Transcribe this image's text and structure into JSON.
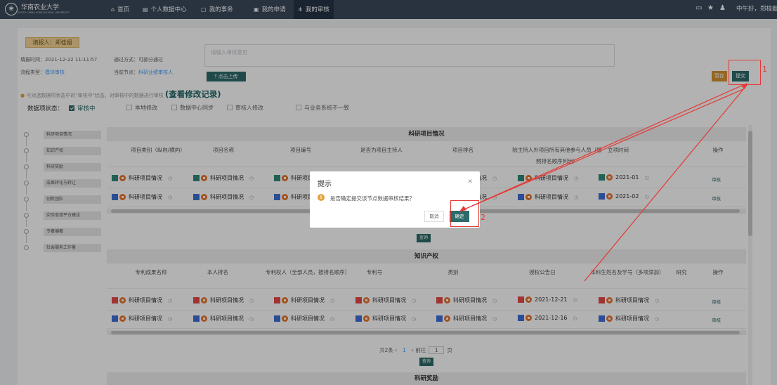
{
  "topbar": {
    "logo_text": "华南农业大学",
    "logo_sub": "SOUTH CHINA AGRICULTURAL UNIVERSITY",
    "nav": [
      {
        "label": "首页",
        "icon": "home-icon"
      },
      {
        "label": "个人数据中心",
        "icon": "id-card-icon"
      },
      {
        "label": "我的事务",
        "icon": "document-icon"
      },
      {
        "label": "我的申请",
        "icon": "form-icon"
      },
      {
        "label": "我的审核",
        "icon": "sitemap-icon"
      }
    ],
    "greeting": "中午好，郑桂姻！"
  },
  "info": {
    "filler": "填报人：郑桂姻",
    "fill_time": "填报时间：2021-12-22 11:11:57",
    "pass_mode": "通过方式：可部分通过",
    "flow_type_label": "流程类型：",
    "flow_type": "模块审核",
    "node_label": "当前节点：",
    "node": "科研业绩审核人",
    "opinion_placeholder": "请输入审核意见",
    "upload": "点击上传",
    "save": "暂存",
    "submit": "提交"
  },
  "note": {
    "text": "可对选数据项状态中的\"审核中\"状态，对审核中的数据进行审核",
    "link": "(查看修改记录)"
  },
  "status": {
    "label": "数据项状态：",
    "options": [
      "审核中",
      "本地修改",
      "数据中心同步",
      "审核人修改",
      "与业务系统不一致"
    ]
  },
  "sidebar": [
    "科研项目情况",
    "知识产权",
    "科研奖励",
    "成果转化与转让",
    "创新团队",
    "实验室或平台建设",
    "专著编著",
    "社会服务工作量"
  ],
  "section1": {
    "title": "科研项目情况",
    "headers": [
      "项目类别（纵向/横向）",
      "项目名称",
      "项目编号",
      "是否为项目主持人",
      "项目排名",
      "除主持人外项目所有其他参与人员（按照排名顺序列出）",
      "立项时间",
      "操作"
    ],
    "cell_text": "科研项目情况",
    "dates": [
      "2021-01",
      "2021-02"
    ],
    "action": "审核",
    "query": "查询"
  },
  "section2": {
    "title": "知识产权",
    "headers": [
      "专利成果名称",
      "本人排名",
      "专利权人（全部人员，按排名顺序）",
      "专利号",
      "类别",
      "授权公告日",
      "本科生姓名及学号（多项添加）",
      "研究",
      "操作"
    ],
    "cell_text": "科研项目情况",
    "dates": [
      "2021-12-21",
      "2021-12-16"
    ],
    "action": "审核",
    "query": "查询"
  },
  "pager": {
    "total": "共2条",
    "page": "1",
    "goto": "前往",
    "goto_val": "1",
    "unit": "页"
  },
  "section3": {
    "title": "科研奖励"
  },
  "dialog": {
    "title": "提示",
    "message": "是否确定提交该节点数据审核结果？",
    "cancel": "取消",
    "confirm": "确定"
  },
  "annotations": {
    "label1": "1",
    "label2": "2",
    "color": "#e53935"
  }
}
